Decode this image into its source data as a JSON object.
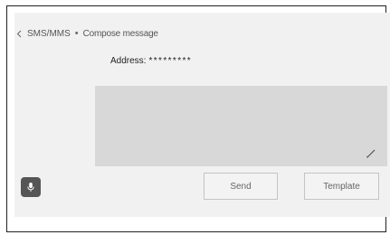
{
  "header": {
    "back_icon": "chevron-left-icon",
    "app_name": "SMS/MMS",
    "separator": "•",
    "screen_title": "Compose message"
  },
  "address": {
    "label": "Address:",
    "value": "*********"
  },
  "message": {
    "placeholder": "",
    "edit_icon": "pencil-icon"
  },
  "buttons": {
    "mic_icon": "microphone-icon",
    "send_label": "Send",
    "template_label": "Template"
  },
  "colors": {
    "screen_background": "#f1f1f1",
    "message_area": "#d8d8d8",
    "mic_button": "#555555",
    "button_border": "#c4c4c4"
  }
}
